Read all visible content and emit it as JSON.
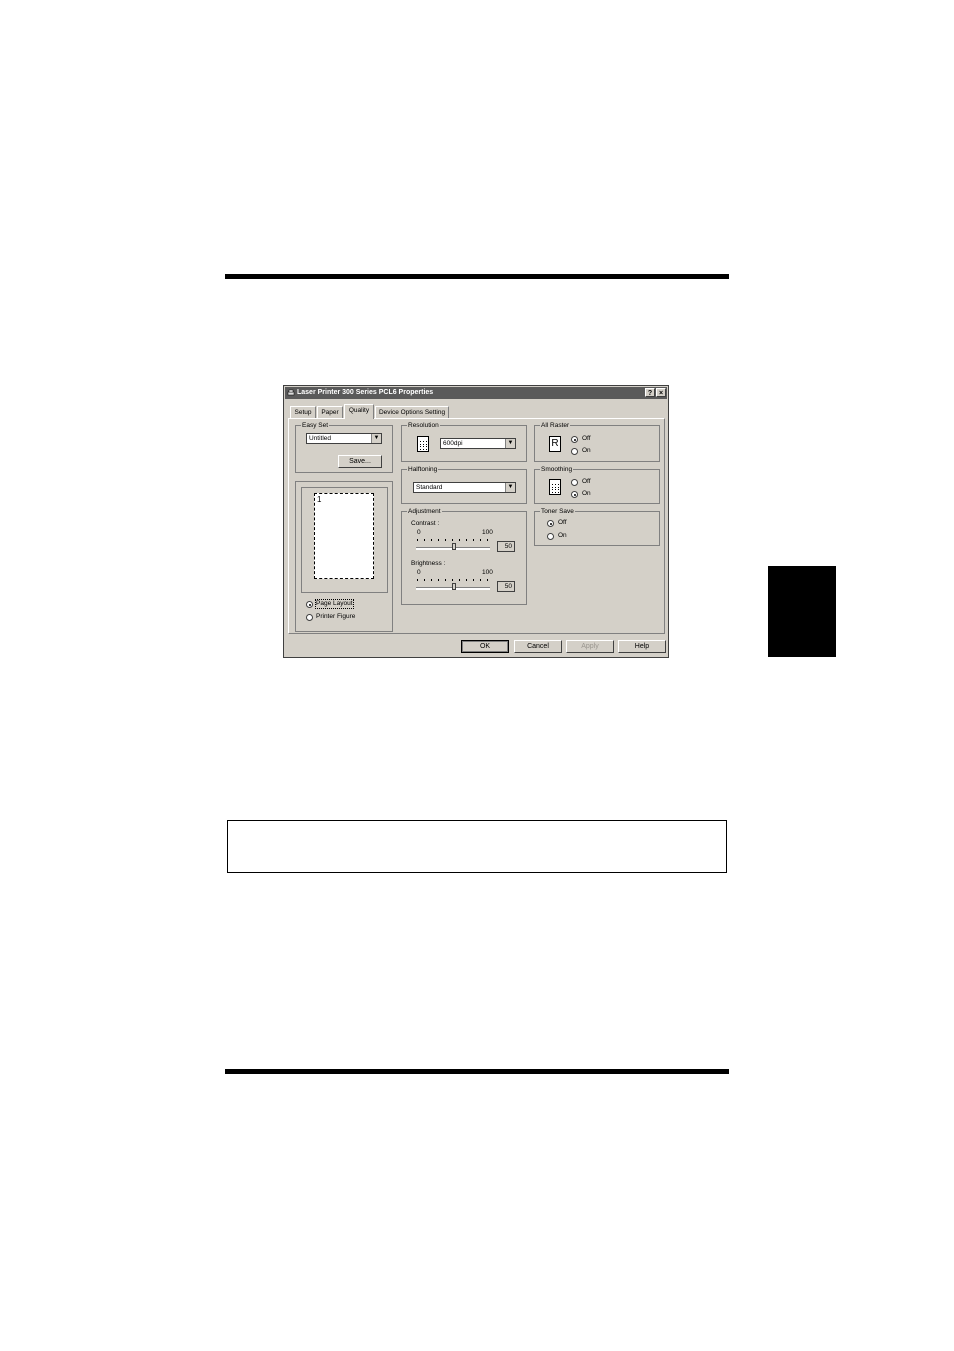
{
  "dialog": {
    "title": "Laser Printer 300 Series PCL6  Properties",
    "help_btn": "?",
    "close_btn": "×",
    "tabs": [
      {
        "label": "Setup"
      },
      {
        "label": "Paper"
      },
      {
        "label": "Quality"
      },
      {
        "label": "Device Options Setting"
      }
    ],
    "active_tab": "Quality"
  },
  "easy_set": {
    "label": "Easy Set",
    "value": "Untitled",
    "save_label": "Save..."
  },
  "preview": {
    "page_number": "1",
    "options": [
      {
        "label": "Page Layout",
        "selected": true
      },
      {
        "label": "Printer Figure",
        "selected": false
      }
    ]
  },
  "resolution": {
    "label": "Resolution",
    "value": "600dpi"
  },
  "halftoning": {
    "label": "Halftoning",
    "value": "Standard"
  },
  "adjustment": {
    "label": "Adjustment",
    "contrast": {
      "label": "Contrast :",
      "min": "0",
      "max": "100",
      "value": "50"
    },
    "brightness": {
      "label": "Brightness :",
      "min": "0",
      "max": "100",
      "value": "50"
    }
  },
  "all_raster": {
    "label": "All Raster",
    "icon_letter": "R",
    "options": [
      {
        "label": "Off",
        "selected": true
      },
      {
        "label": "On",
        "selected": false
      }
    ]
  },
  "smoothing": {
    "label": "Smoothing",
    "options": [
      {
        "label": "Off",
        "selected": false
      },
      {
        "label": "On",
        "selected": true
      }
    ]
  },
  "toner_save": {
    "label": "Toner Save",
    "options": [
      {
        "label": "Off",
        "selected": true
      },
      {
        "label": "On",
        "selected": false
      }
    ]
  },
  "buttons": {
    "ok": "OK",
    "cancel": "Cancel",
    "apply": "Apply",
    "help": "Help"
  },
  "colors": {
    "dialog_face": "#d4d0c8",
    "titlebar": "#5a5a5a",
    "page_rule": "#000000"
  }
}
